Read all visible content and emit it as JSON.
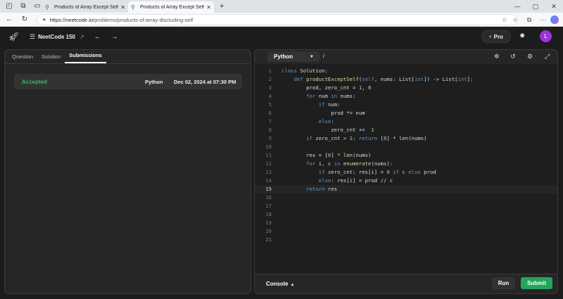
{
  "browser": {
    "tabs": [
      {
        "title": "Products of Array Except Self - Ne",
        "active": false
      },
      {
        "title": "Products of Array Except Self - Ne",
        "active": true
      }
    ],
    "url_host": "https://neetcode.io",
    "url_path": "/problems/products-of-array-discluding-self"
  },
  "header": {
    "course": "NeetCode 150",
    "pro_label": "Pro",
    "avatar_letter": "L"
  },
  "left": {
    "tabs": [
      "Question",
      "Solution",
      "Submissions"
    ],
    "active_tab": "Submissions",
    "submission": {
      "status": "Accepted",
      "language": "Python",
      "date": "Dec 02, 2024 at 07:30 PM"
    }
  },
  "editor": {
    "language": "Python",
    "info": "i",
    "current_line": 15,
    "line_numbers": [
      "1",
      "2",
      "3",
      "4",
      "5",
      "6",
      "7",
      "8",
      "9",
      "10",
      "11",
      "12",
      "13",
      "14",
      "15",
      "16",
      "17",
      "18",
      "19",
      "20",
      "21"
    ]
  },
  "bottom": {
    "console_label": "Console",
    "run_label": "Run",
    "submit_label": "Submit"
  },
  "colors": {
    "accepted": "#3cb86b",
    "submit": "#23a55a",
    "avatar": "#9b35d6"
  }
}
